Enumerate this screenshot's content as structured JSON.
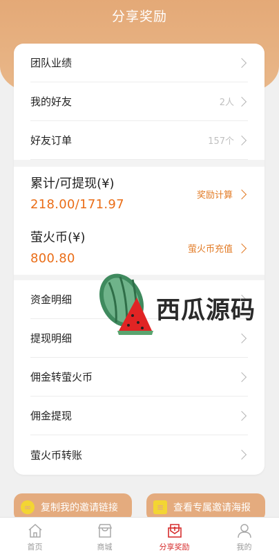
{
  "header": {
    "title": "分享奖励"
  },
  "menu_top": [
    {
      "label": "团队业绩",
      "hint": ""
    },
    {
      "label": "我的好友",
      "hint": "2人"
    },
    {
      "label": "好友订单",
      "hint": "157个"
    }
  ],
  "stats": [
    {
      "label": "累计/可提现(¥)",
      "value": "218.00/171.97",
      "action": "奖励计算"
    },
    {
      "label": "萤火币(¥)",
      "value": "800.80",
      "action": "萤火币充值"
    }
  ],
  "menu_bottom": [
    {
      "label": "资金明细"
    },
    {
      "label": "提现明细"
    },
    {
      "label": "佣金转萤火币"
    },
    {
      "label": "佣金提现"
    },
    {
      "label": "萤火币转账"
    }
  ],
  "watermark": {
    "text": "西瓜源码"
  },
  "share": {
    "copy_label": "复制我的邀请链接",
    "poster_label": "查看专属邀请海报"
  },
  "tabs": [
    {
      "label": "首页",
      "icon": "home-icon"
    },
    {
      "label": "商城",
      "icon": "shop-icon"
    },
    {
      "label": "分享奖励",
      "icon": "share-reward-icon",
      "active": true
    },
    {
      "label": "我的",
      "icon": "user-icon"
    }
  ],
  "colors": {
    "accent": "#e4a977",
    "orange_text": "#ea6d17",
    "active_tab": "#d62d2d"
  }
}
